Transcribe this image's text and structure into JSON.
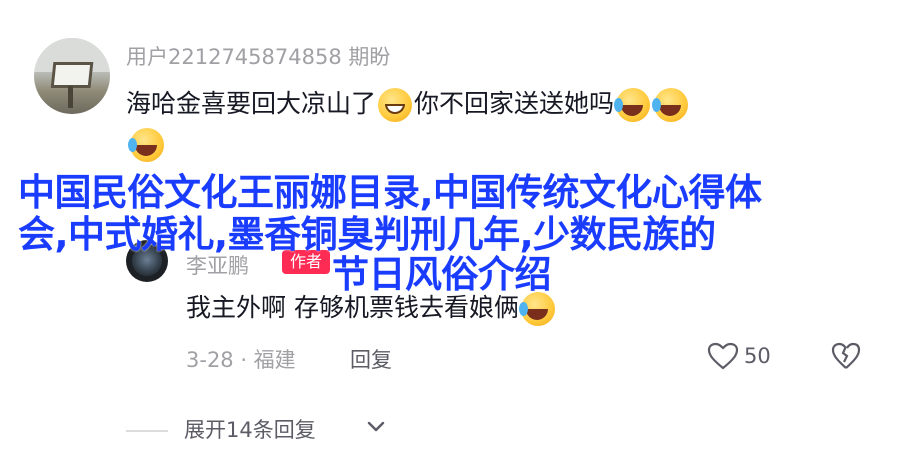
{
  "overlay": {
    "line1": "中国民俗文化王丽娜目录,中国传统文化心得体",
    "line2": "会,中式婚礼,墨香铜臭判刑几年,少数民族的",
    "line3": "节日风俗介绍"
  },
  "comment1": {
    "username": "用户2212745874858 期盼",
    "text_part1": "海哈金喜要回大凉山了",
    "text_part2": "你不回家送送她吗"
  },
  "comment2": {
    "username": "李亚鹏",
    "author_badge": "作者",
    "text": "我主外啊 存够机票钱去看娘俩",
    "date_location": "3-28 · 福建",
    "reply_label": "回复",
    "like_count": "50"
  },
  "expand": {
    "label": "展开14条回复"
  },
  "icons": {
    "emoji_grin": "grinning-face-emoji",
    "emoji_lol": "rolling-laughing-emoji",
    "like": "heart-outline-icon",
    "dislike": "broken-heart-icon",
    "chevron": "chevron-down-icon"
  }
}
